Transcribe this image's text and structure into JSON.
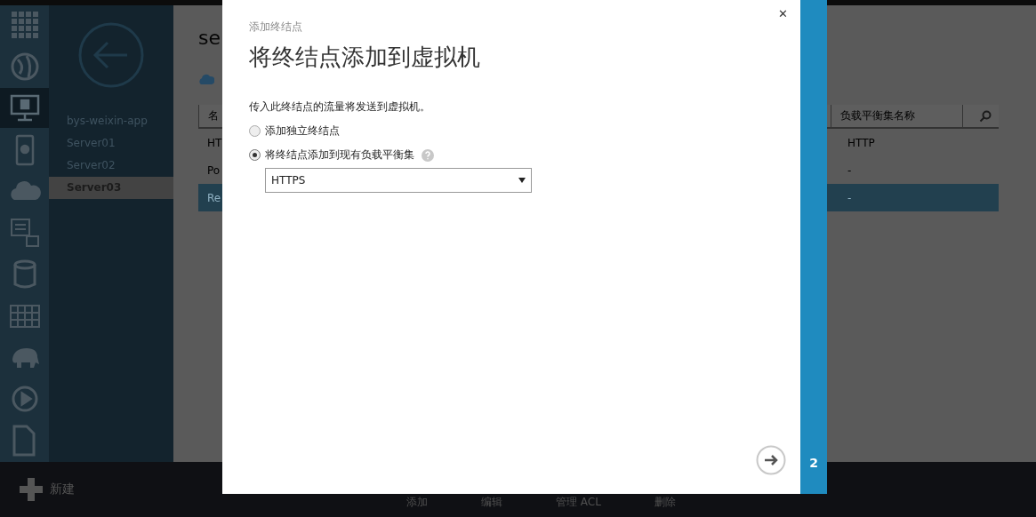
{
  "nav_icons": [
    {
      "kind": "grid",
      "selected": false
    },
    {
      "kind": "globe",
      "selected": false
    },
    {
      "kind": "monitor",
      "selected": true
    },
    {
      "kind": "phone",
      "selected": false
    },
    {
      "kind": "cloud",
      "selected": false
    },
    {
      "kind": "docs",
      "selected": false
    },
    {
      "kind": "db",
      "selected": false
    },
    {
      "kind": "table",
      "selected": false
    },
    {
      "kind": "elephant",
      "selected": false
    },
    {
      "kind": "play",
      "selected": false
    },
    {
      "kind": "doc",
      "selected": false
    }
  ],
  "sidebar": {
    "items": [
      {
        "label": "bys-weixin-app",
        "selected": false
      },
      {
        "label": "Server01",
        "selected": false
      },
      {
        "label": "Server02",
        "selected": false
      },
      {
        "label": "Server03",
        "selected": true
      }
    ]
  },
  "content": {
    "title": "se",
    "table": {
      "columns": [
        "名",
        "负载平衡集名称"
      ],
      "rows": [
        {
          "cells": [
            "HT",
            "HTTP"
          ],
          "selected": false
        },
        {
          "cells": [
            "Po",
            "-"
          ],
          "selected": false
        },
        {
          "cells": [
            "Re",
            "-"
          ],
          "selected": true
        }
      ]
    }
  },
  "dialog": {
    "subtitle": "添加终结点",
    "title": "将终结点添加到虚拟机",
    "description": "传入此终结点的流量将发送到虚拟机。",
    "options": [
      {
        "label": "添加独立终结点",
        "selected": false,
        "help": false
      },
      {
        "label": "将终结点添加到现有负载平衡集",
        "selected": true,
        "help": true
      }
    ],
    "select": {
      "value": "HTTPS"
    },
    "step": "2",
    "close": "✕"
  },
  "command_bar": {
    "new": "新建",
    "actions": [
      "添加",
      "编辑",
      "管理 ACL",
      "删除"
    ]
  }
}
